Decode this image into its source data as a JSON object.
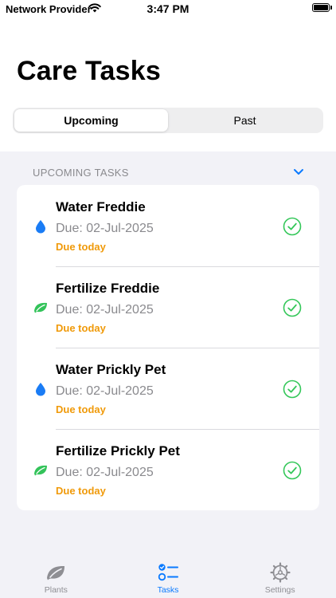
{
  "status_bar": {
    "provider": "Network Provider",
    "time": "3:47 PM",
    "wifi_icon": "wifi-icon",
    "battery_icon": "battery-icon"
  },
  "header": {
    "title": "Care Tasks"
  },
  "segmented_control": {
    "segments": [
      {
        "label": "Upcoming",
        "selected": true
      },
      {
        "label": "Past",
        "selected": false
      }
    ]
  },
  "section": {
    "header": "UPCOMING TASKS",
    "toggle_icon": "chevron-down-icon"
  },
  "tasks": [
    {
      "title": "Water Freddie",
      "due": "Due: 02-Jul-2025",
      "status": "Due today",
      "icon": "water-drop-icon"
    },
    {
      "title": "Fertilize Freddie",
      "due": "Due: 02-Jul-2025",
      "status": "Due today",
      "icon": "leaf-icon"
    },
    {
      "title": "Water Prickly Pet",
      "due": "Due: 02-Jul-2025",
      "status": "Due today",
      "icon": "water-drop-icon"
    },
    {
      "title": "Fertilize Prickly Pet",
      "due": "Due: 02-Jul-2025",
      "status": "Due today",
      "icon": "leaf-icon"
    }
  ],
  "tab_bar": {
    "tabs": [
      {
        "label": "Plants",
        "icon": "leaf-icon",
        "selected": false
      },
      {
        "label": "Tasks",
        "icon": "checklist-icon",
        "selected": true
      },
      {
        "label": "Settings",
        "icon": "gear-icon",
        "selected": false
      }
    ]
  },
  "colors": {
    "accent": "#0a7aff",
    "water": "#1a7cf5",
    "leaf": "#33c35a",
    "due_today": "#f09a0a",
    "complete_check": "#34c759",
    "secondary_text": "#8a8a8e",
    "grouped_background": "#f2f2f7"
  }
}
